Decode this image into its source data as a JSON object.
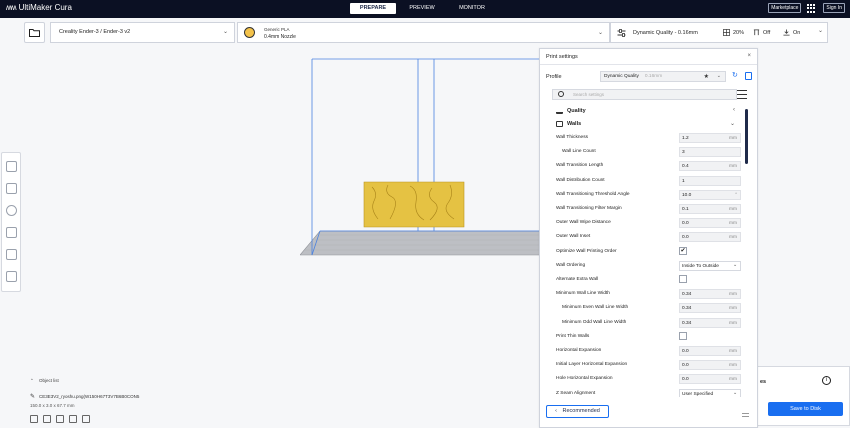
{
  "app": {
    "title": "UltiMaker Cura"
  },
  "stages": [
    {
      "label": "PREPARE",
      "active": true
    },
    {
      "label": "PREVIEW",
      "active": false
    },
    {
      "label": "MONITOR",
      "active": false
    }
  ],
  "top_right": {
    "marketplace": "Marketplace",
    "sign_in": "Sign In"
  },
  "printer": {
    "name": "Creality Ender-3 / Ender-3 v2"
  },
  "material": {
    "name": "Generic PLA",
    "nozzle": "0.4mm Nozzle"
  },
  "quality_bar": {
    "profile": "Dynamic Quality - 0.16mm",
    "infill": "20%",
    "support": "Off",
    "adhesion": "On"
  },
  "print_settings": {
    "title": "Print settings",
    "profile_label": "Profile",
    "profile_value": "Dynamic Quality",
    "profile_suffix": "0.16mm",
    "search_placeholder": "Search settings",
    "categories": {
      "quality": "Quality",
      "walls": "Walls"
    },
    "rows": [
      {
        "label": "Wall Thickness",
        "indent": 0,
        "type": "input",
        "value": "1.2",
        "unit": "mm"
      },
      {
        "label": "Wall Line Count",
        "indent": 1,
        "type": "input",
        "value": "3",
        "unit": ""
      },
      {
        "label": "Wall Transition Length",
        "indent": 0,
        "type": "input",
        "value": "0.4",
        "unit": "mm"
      },
      {
        "label": "Wall Distribution Count",
        "indent": 0,
        "type": "input",
        "value": "1",
        "unit": ""
      },
      {
        "label": "Wall Transitioning Threshold Angle",
        "indent": 0,
        "type": "input",
        "value": "10.0",
        "unit": "°"
      },
      {
        "label": "Wall Transitioning Filter Margin",
        "indent": 0,
        "type": "input",
        "value": "0.1",
        "unit": "mm"
      },
      {
        "label": "Outer Wall Wipe Distance",
        "indent": 0,
        "type": "input",
        "value": "0.0",
        "unit": "mm"
      },
      {
        "label": "Outer Wall Inset",
        "indent": 0,
        "type": "input",
        "value": "0.0",
        "unit": "mm"
      },
      {
        "label": "Optimize Wall Printing Order",
        "indent": 0,
        "type": "checkbox",
        "checked": true,
        "mark": "✔"
      },
      {
        "label": "Wall Ordering",
        "indent": 0,
        "type": "dropdown",
        "value": "Inside To Outside"
      },
      {
        "label": "Alternate Extra Wall",
        "indent": 0,
        "type": "checkbox",
        "checked": false,
        "mark": ""
      },
      {
        "label": "Minimum Wall Line Width",
        "indent": 0,
        "type": "input",
        "value": "0.34",
        "unit": "mm"
      },
      {
        "label": "Minimum Even Wall Line Width",
        "indent": 1,
        "type": "input",
        "value": "0.34",
        "unit": "mm"
      },
      {
        "label": "Minimum Odd Wall Line Width",
        "indent": 1,
        "type": "input",
        "value": "0.34",
        "unit": "mm"
      },
      {
        "label": "Print Thin Walls",
        "indent": 0,
        "type": "checkbox",
        "checked": false,
        "mark": ""
      },
      {
        "label": "Horizontal Expansion",
        "indent": 0,
        "type": "input",
        "value": "0.0",
        "unit": "mm"
      },
      {
        "label": "Initial Layer Horizontal Expansion",
        "indent": 0,
        "type": "input",
        "value": "0.0",
        "unit": "mm"
      },
      {
        "label": "Hole Horizontal Expansion",
        "indent": 0,
        "type": "input",
        "value": "0.0",
        "unit": "mm"
      },
      {
        "label": "Z Seam Alignment",
        "indent": 0,
        "type": "dropdown",
        "value": "User Specified"
      }
    ],
    "recommended_label": "Recommended"
  },
  "object_list": {
    "header": "Object list",
    "file_name": "CE3E3V2_ryoshu.png(W150H67T3V7B6B0CON5",
    "dimensions": "150.0 x 3.0 x 67.7 mm"
  },
  "action_panel": {
    "label": "es",
    "save_button": "Save to Disk"
  }
}
